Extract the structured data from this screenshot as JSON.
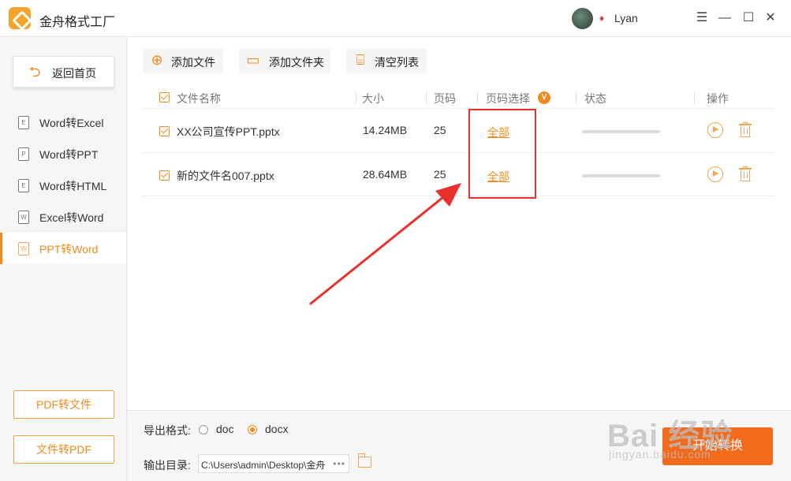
{
  "app": {
    "title": "金舟格式工厂",
    "username": "Lyan"
  },
  "window": {
    "minimize": "—",
    "maximize": "☐",
    "close": "✕"
  },
  "sidebar": {
    "home_label": "返回首页",
    "items": [
      {
        "icon_text": "E",
        "label": "Word转Excel",
        "active": false
      },
      {
        "icon_text": "P",
        "label": "Word转PPT",
        "active": false
      },
      {
        "icon_text": "E",
        "label": "Word转HTML",
        "active": false
      },
      {
        "icon_text": "W",
        "label": "Excel转Word",
        "active": false
      },
      {
        "icon_text": "W",
        "label": "PPT转Word",
        "active": true
      }
    ],
    "bottom_buttons": [
      "PDF转文件",
      "文件转PDF"
    ]
  },
  "toolbar": {
    "add_file": "添加文件",
    "add_folder": "添加文件夹",
    "clear_list": "清空列表"
  },
  "table": {
    "headers": {
      "name": "文件名称",
      "size": "大小",
      "pages": "页码",
      "page_select": "页码选择",
      "page_select_badge": "V",
      "status": "状态",
      "actions": "操作"
    },
    "rows": [
      {
        "name": "XX公司宣传PPT.pptx",
        "size": "14.24MB",
        "pages": "25",
        "page_select": "全部",
        "progress": 0
      },
      {
        "name": "新的文件名007.pptx",
        "size": "28.64MB",
        "pages": "25",
        "page_select": "全部",
        "progress": 0
      }
    ]
  },
  "footer": {
    "format_label": "导出格式:",
    "formats": [
      {
        "label": "doc",
        "selected": false
      },
      {
        "label": "docx",
        "selected": true
      }
    ],
    "output_label": "输出目录:",
    "output_path": "C:\\Users\\admin\\Desktop\\金舟",
    "more": "•••",
    "start_label": "开始转换"
  },
  "watermark": {
    "top": "Bai 经验",
    "bottom": "jingyan.baidu.com"
  },
  "colors": {
    "accent": "#f08a1c",
    "start_button": "#f26b1d",
    "annotation": "#e8302c"
  }
}
